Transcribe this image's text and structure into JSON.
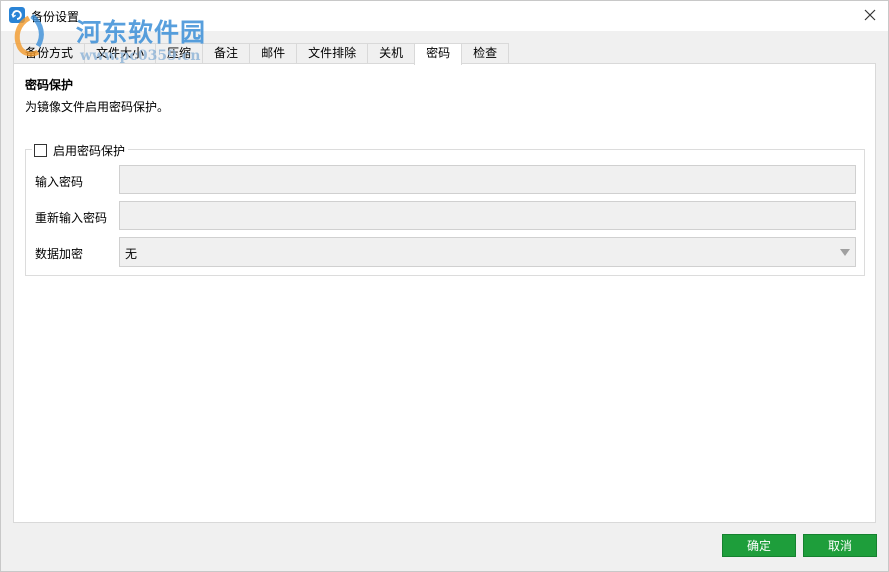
{
  "window": {
    "title": "备份设置",
    "icon": "app-backup-icon",
    "close_icon": "close-icon"
  },
  "watermark": {
    "name": "河东软件园",
    "url": "www.pc0359.cn"
  },
  "tabs": [
    {
      "label": "备份方式",
      "active": false
    },
    {
      "label": "文件大小",
      "active": false
    },
    {
      "label": "压缩",
      "active": false
    },
    {
      "label": "备注",
      "active": false
    },
    {
      "label": "邮件",
      "active": false
    },
    {
      "label": "文件排除",
      "active": false
    },
    {
      "label": "关机",
      "active": false
    },
    {
      "label": "密码",
      "active": true
    },
    {
      "label": "检查",
      "active": false
    }
  ],
  "password_section": {
    "title": "密码保护",
    "description": "为镜像文件启用密码保护。",
    "enable_label": "启用密码保护",
    "enabled": false,
    "password_label": "输入密码",
    "password_value": "",
    "confirm_label": "重新输入密码",
    "confirm_value": "",
    "encryption_label": "数据加密",
    "encryption_value": "无"
  },
  "footer": {
    "ok_label": "确定",
    "cancel_label": "取消"
  },
  "colors": {
    "button_green": "#1e9e3b",
    "panel_bg": "#ffffff",
    "window_bg": "#f0f0f0",
    "app_icon_blue": "#2a84d6"
  }
}
